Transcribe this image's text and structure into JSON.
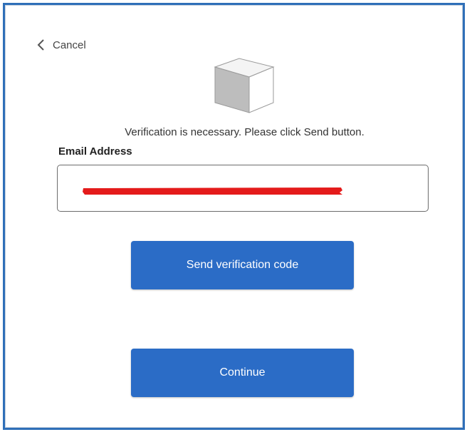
{
  "dialog": {
    "cancel_label": "Cancel",
    "logo_icon": "cube-logo-icon",
    "instruction": "Verification is necessary. Please click Send button."
  },
  "form": {
    "email_label": "Email Address",
    "email_value": "",
    "email_redacted": true
  },
  "buttons": {
    "send_code_label": "Send verification code",
    "continue_label": "Continue"
  },
  "colors": {
    "accent": "#2b6cc6",
    "frame": "#2f6fb8",
    "redaction": "#e41b1b"
  }
}
